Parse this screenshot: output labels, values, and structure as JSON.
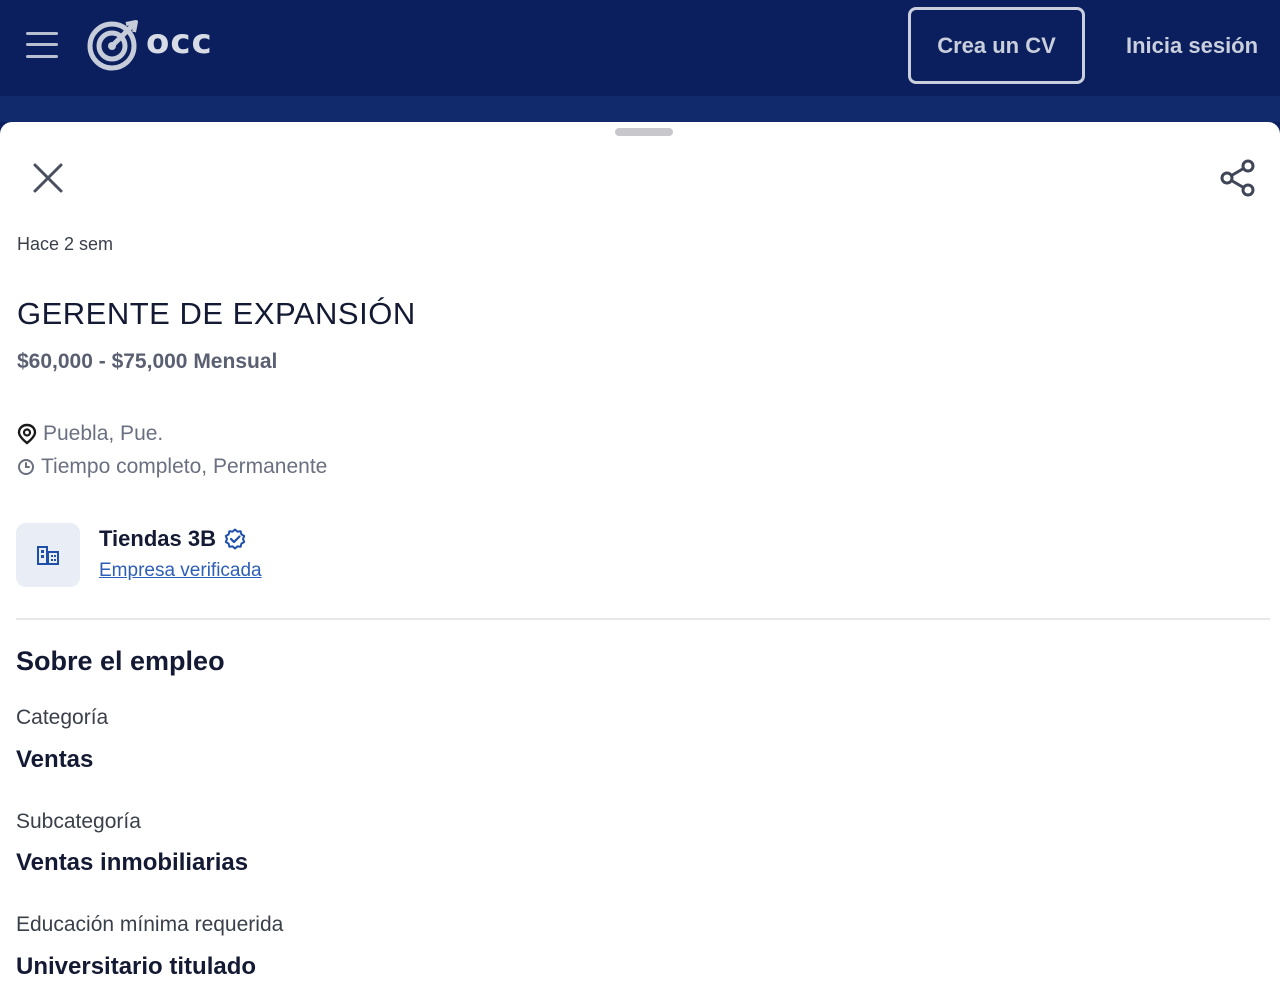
{
  "header": {
    "logo_text": "occ",
    "create_cv_label": "Crea un CV",
    "login_label": "Inicia sesión"
  },
  "job": {
    "posted": "Hace 2 sem",
    "title": "GERENTE DE EXPANSIÓN",
    "salary": "$60,000 - $75,000 Mensual",
    "location": "Puebla, Pue.",
    "employment_type": "Tiempo completo, Permanente"
  },
  "company": {
    "name": "Tiendas 3B",
    "verified_label": "Empresa verificada"
  },
  "about": {
    "title": "Sobre el empleo",
    "fields": [
      {
        "label": "Categoría",
        "value": "Ventas"
      },
      {
        "label": "Subcategoría",
        "value": "Ventas inmobiliarias"
      },
      {
        "label": "Educación mínima requerida",
        "value": "Universitario titulado"
      }
    ]
  },
  "icons": {
    "menu": "hamburger-menu-icon",
    "logo": "target-logo-icon",
    "close": "close-icon",
    "share": "share-icon",
    "location": "location-pin-icon",
    "clock": "clock-icon",
    "company": "building-icon",
    "verified": "verified-badge-icon"
  },
  "colors": {
    "header_bg": "#0b1f5e",
    "link": "#2d5fb8",
    "verified": "#1f4fa8"
  }
}
